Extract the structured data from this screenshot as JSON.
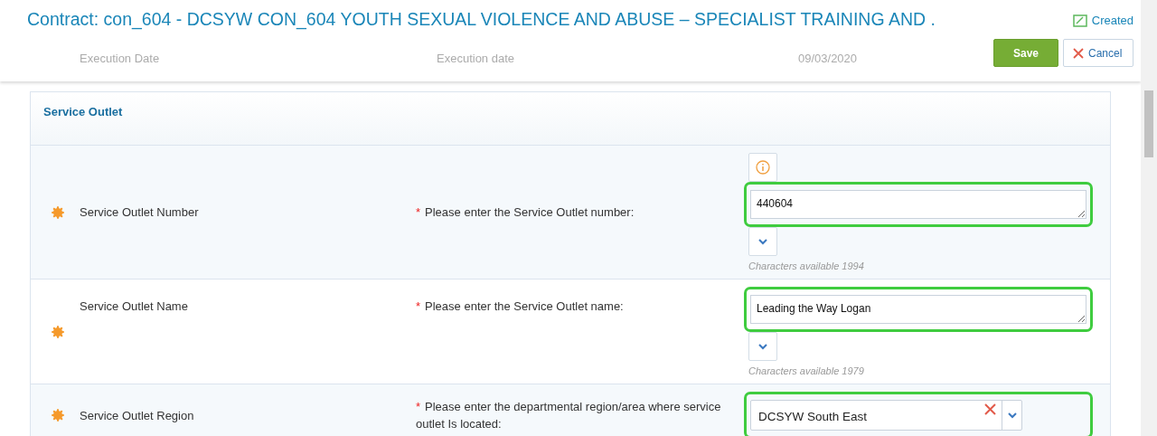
{
  "header": {
    "title": "Contract: con_604 - DCSYW CON_604 YOUTH SEXUAL VIOLENCE AND ABUSE – SPECIALIST TRAINING AND .",
    "status": "Created",
    "buttons": [
      {
        "kind": "save",
        "label": "Save"
      },
      {
        "kind": "cancel",
        "label": "Cancel"
      }
    ]
  },
  "background_row": {
    "label": "Execution Date",
    "prompt": "Execution date",
    "value": "09/03/2020"
  },
  "section": {
    "title": "Service Outlet",
    "rows": [
      {
        "kind": "textarea",
        "label": "Service Outlet Number",
        "prompt": "Please enter the Service Outlet number:",
        "required_mark": "*",
        "value": "440604",
        "info_button": true,
        "highlighted": true,
        "counter": "Characters available 1994"
      },
      {
        "kind": "textarea",
        "label": "Service Outlet Name",
        "prompt": "Please enter the Service Outlet name:",
        "required_mark": "*",
        "value": "Leading the Way Logan",
        "info_button": false,
        "highlighted": true,
        "counter": "Characters available 1979"
      },
      {
        "kind": "select",
        "label": "Service Outlet Region",
        "prompt": "Please enter the departmental region/area where service outlet Is located:",
        "required_mark": "*",
        "value": "DCSYW South East",
        "highlighted": true
      }
    ]
  }
}
